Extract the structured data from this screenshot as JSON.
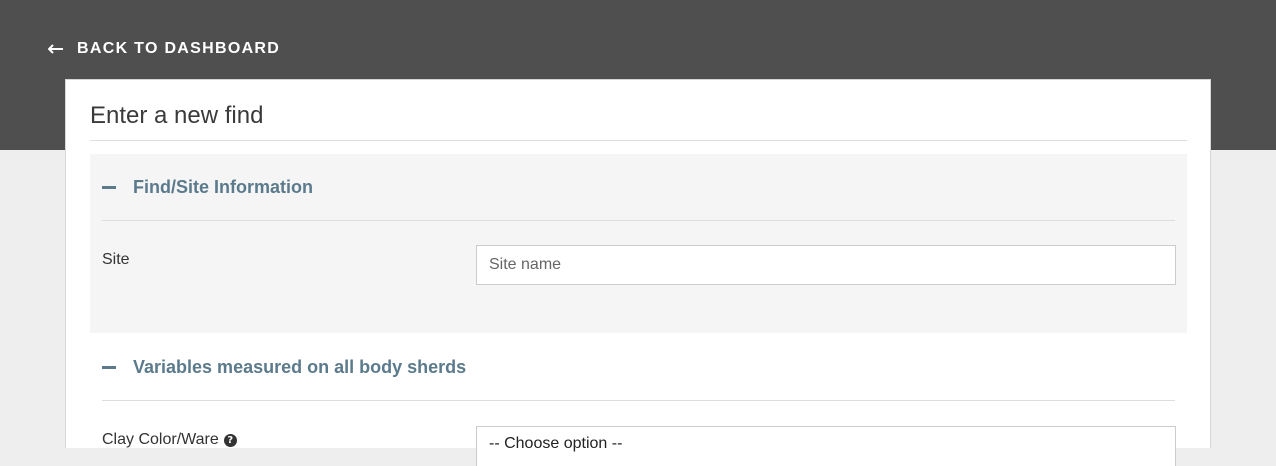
{
  "nav": {
    "back_label": "BACK TO DASHBOARD"
  },
  "page": {
    "title": "Enter a new find"
  },
  "sections": [
    {
      "title": "Find/Site Information",
      "fields": [
        {
          "label": "Site",
          "placeholder": "Site name",
          "value": ""
        }
      ]
    },
    {
      "title": "Variables measured on all body sherds",
      "fields": [
        {
          "label": "Clay Color/Ware",
          "selected": "-- Choose option --"
        }
      ]
    }
  ],
  "icons": {
    "back": "left-arrow-icon",
    "collapse": "minus-icon",
    "help": "question-circle-icon"
  },
  "colors": {
    "header_bg": "#4f4f4f",
    "accent": "#5b7a8c",
    "page_bg": "#eeeeee",
    "section_bg": "#f5f5f5"
  }
}
